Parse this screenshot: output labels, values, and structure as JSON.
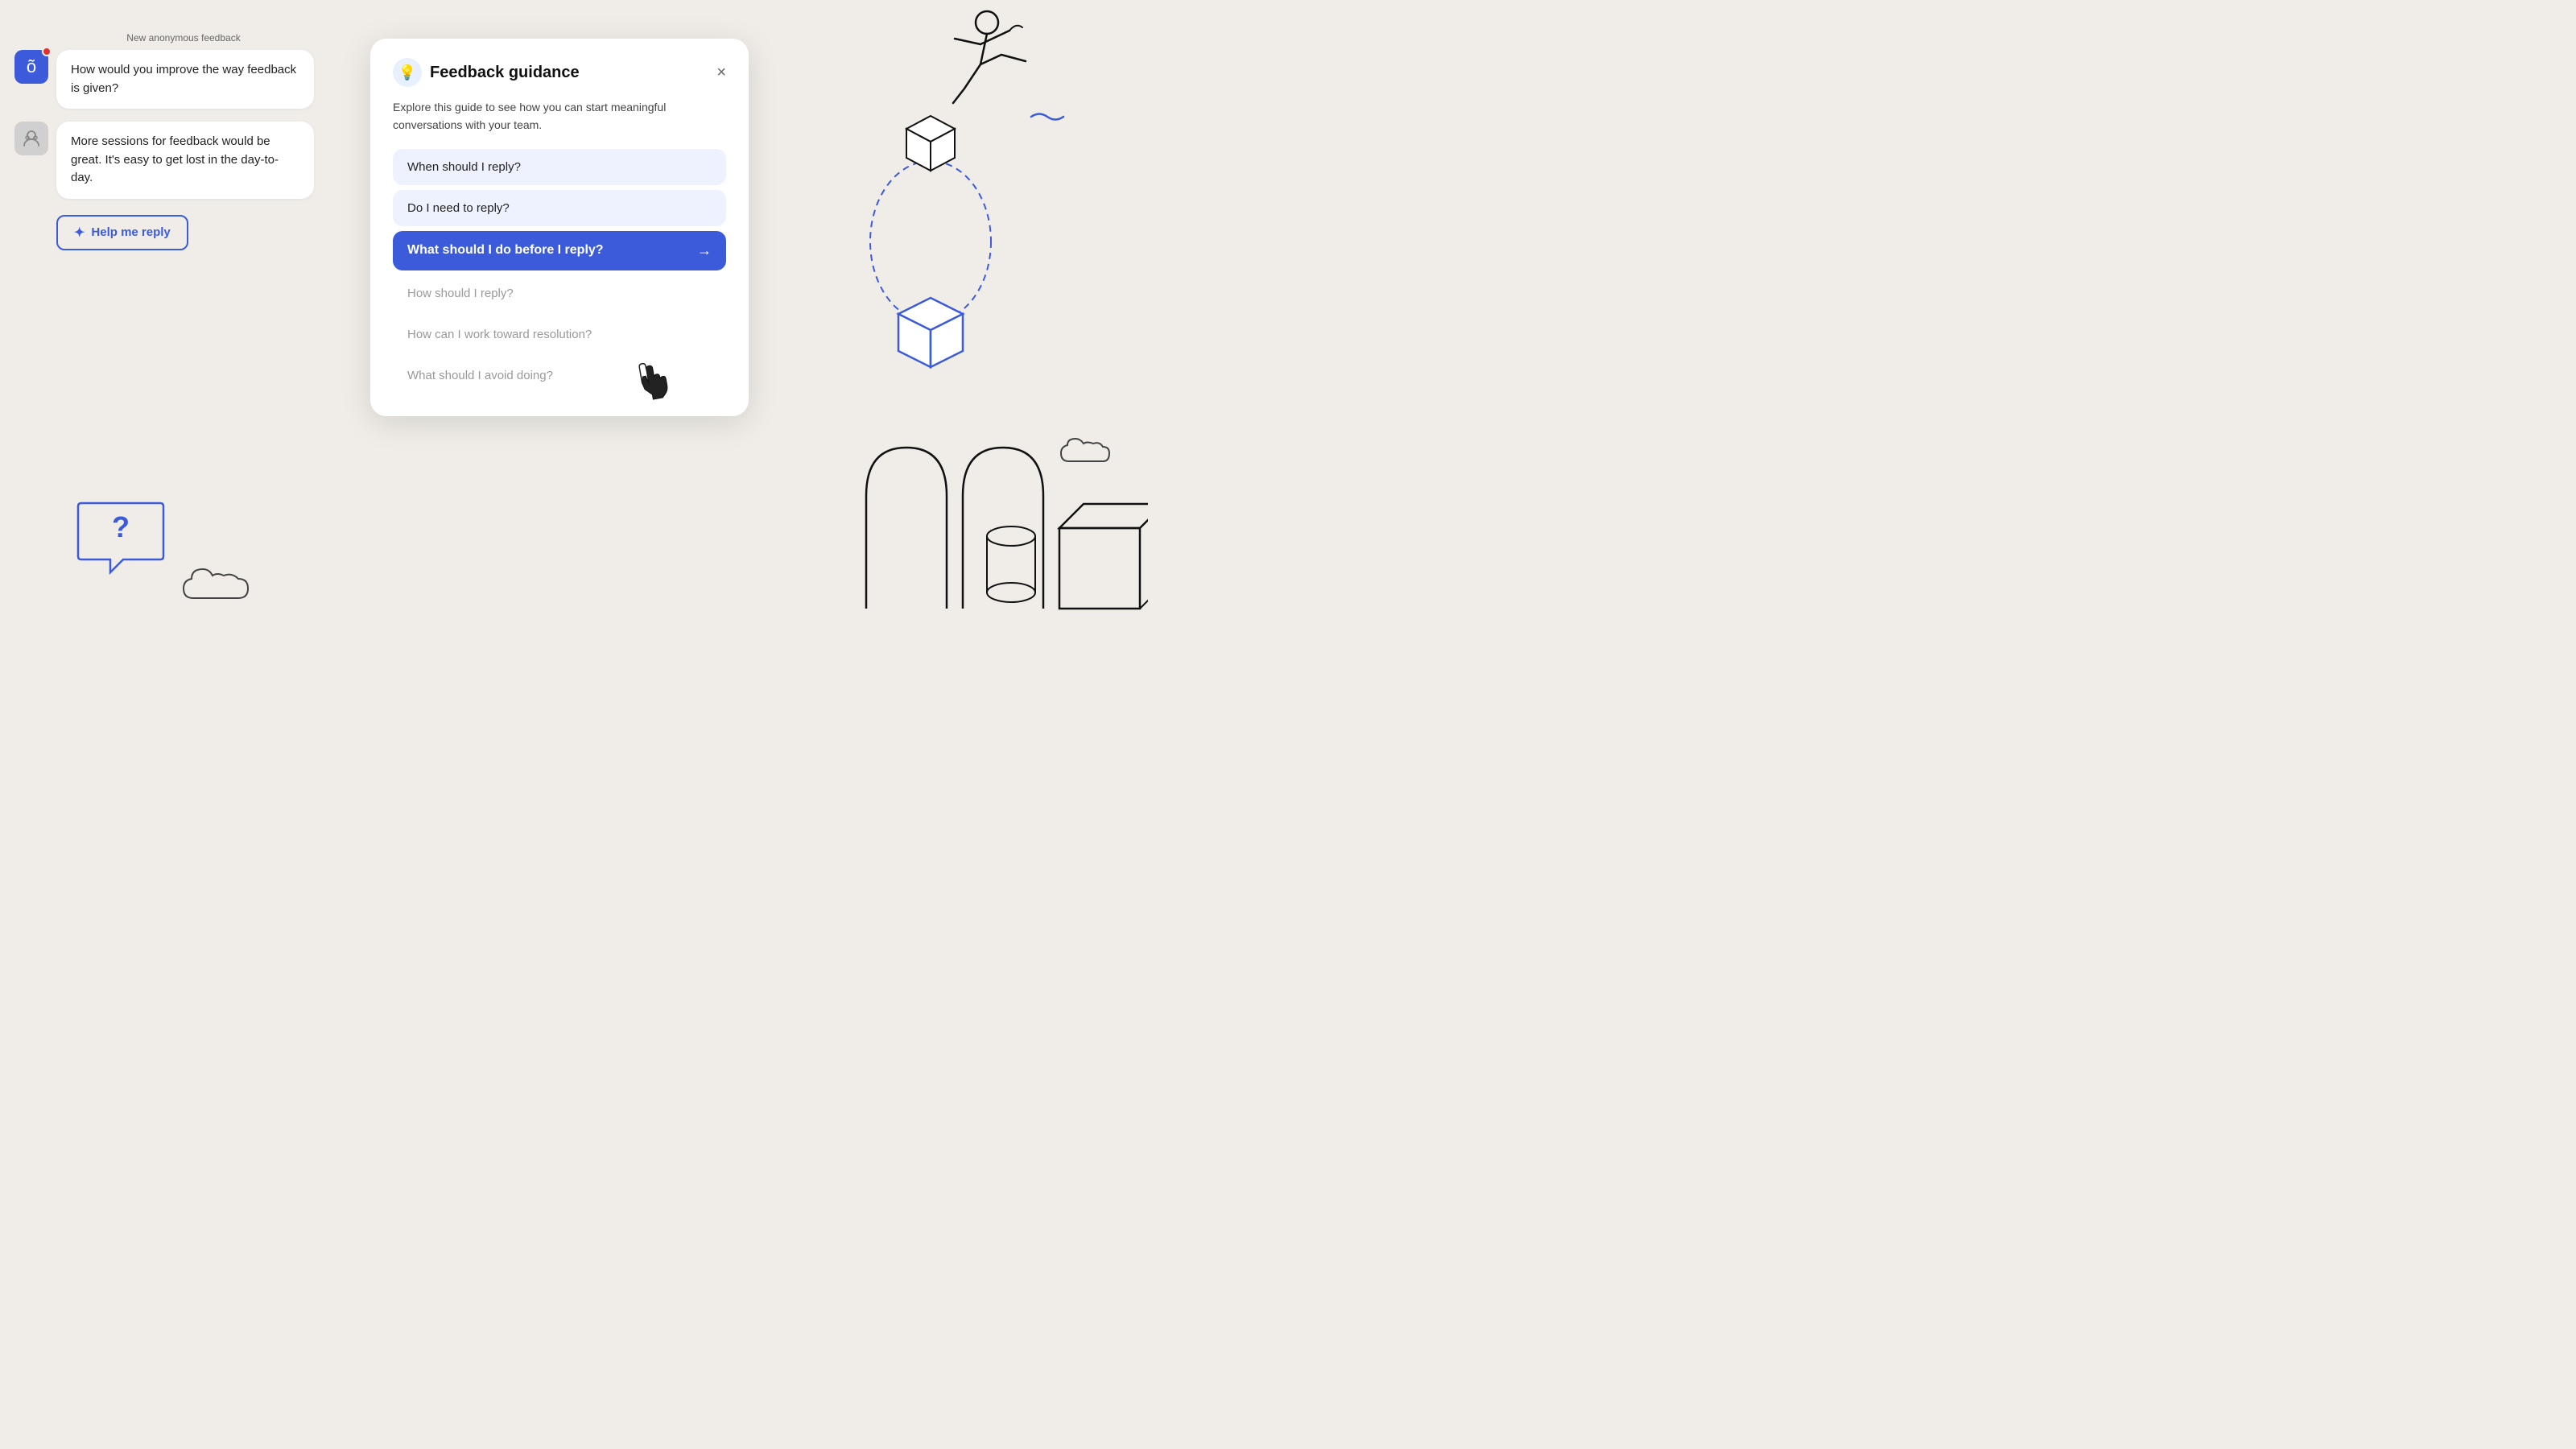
{
  "left": {
    "anon_label": "New anonymous feedback",
    "chat1": {
      "avatar_letter": "õ",
      "message": "How would you improve the way feedback is given?"
    },
    "chat2": {
      "message": "More sessions for feedback would be great. It's easy to get lost in the day-to-day."
    },
    "help_btn_label": "Help me reply"
  },
  "modal": {
    "title": "Feedback guidance",
    "description": "Explore this guide to see how you can start meaningful conversations with your team.",
    "close_label": "×",
    "items": [
      {
        "label": "When should I reply?",
        "style": "normal"
      },
      {
        "label": "Do I need to reply?",
        "style": "normal"
      },
      {
        "label": "What should I do before I reply?",
        "style": "active"
      },
      {
        "label": "How should I reply?",
        "style": "faded"
      },
      {
        "label": "How can I work toward resolution?",
        "style": "faded"
      },
      {
        "label": "What should I avoid doing?",
        "style": "faded"
      }
    ]
  },
  "icons": {
    "lightbulb": "💡",
    "help_btn_icon": "✦",
    "arrow_right": "→"
  }
}
